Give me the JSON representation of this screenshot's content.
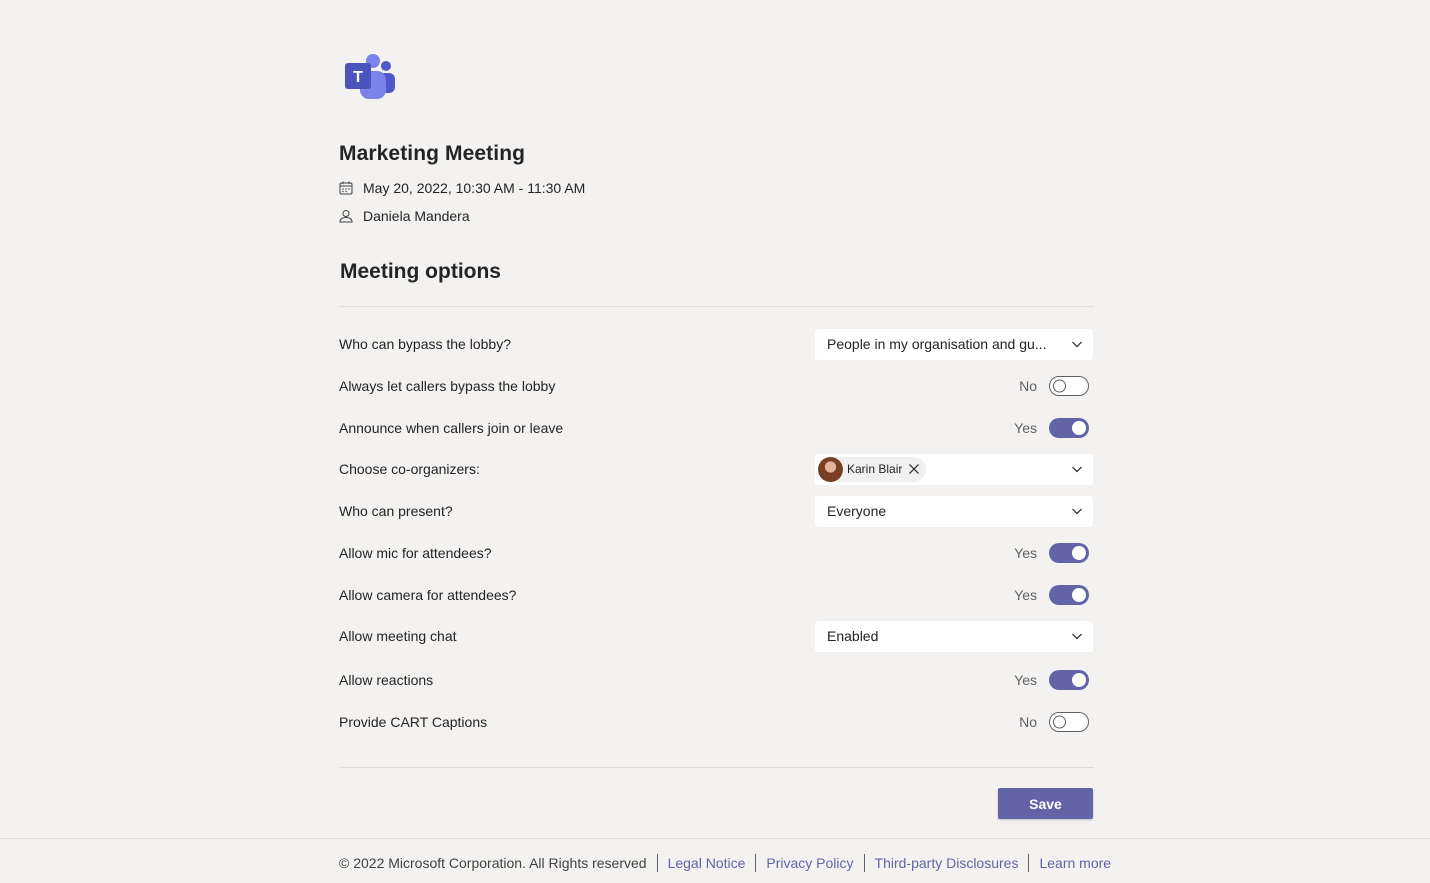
{
  "app": {
    "logo_icon": "microsoft-teams-logo",
    "brand_color": "#6264a7"
  },
  "meeting": {
    "title": "Marketing Meeting",
    "datetime": "May 20, 2022, 10:30 AM - 11:30 AM",
    "organizer": "Daniela Mandera",
    "datetime_icon": "calendar-icon",
    "organizer_icon": "person-icon"
  },
  "options": {
    "section_title": "Meeting options",
    "bypass_lobby": {
      "label": "Who can bypass the lobby?",
      "value": "People in my organisation and gu..."
    },
    "callers_bypass": {
      "label": "Always let callers bypass the lobby",
      "state": "No"
    },
    "announce_callers": {
      "label": "Announce when callers join or leave",
      "state": "Yes"
    },
    "co_organizers": {
      "label": "Choose co-organizers:",
      "selected": [
        "Karin Blair"
      ]
    },
    "who_can_present": {
      "label": "Who can present?",
      "value": "Everyone"
    },
    "allow_mic": {
      "label": "Allow mic for attendees?",
      "state": "Yes"
    },
    "allow_camera": {
      "label": "Allow camera for attendees?",
      "state": "Yes"
    },
    "meeting_chat": {
      "label": "Allow meeting chat",
      "value": "Enabled"
    },
    "allow_reactions": {
      "label": "Allow reactions",
      "state": "Yes"
    },
    "cart_captions": {
      "label": "Provide CART Captions",
      "state": "No"
    },
    "save_label": "Save"
  },
  "footer": {
    "copyright": "© 2022 Microsoft Corporation. All Rights reserved",
    "links": [
      "Legal Notice",
      "Privacy Policy",
      "Third-party Disclosures",
      "Learn more"
    ]
  }
}
